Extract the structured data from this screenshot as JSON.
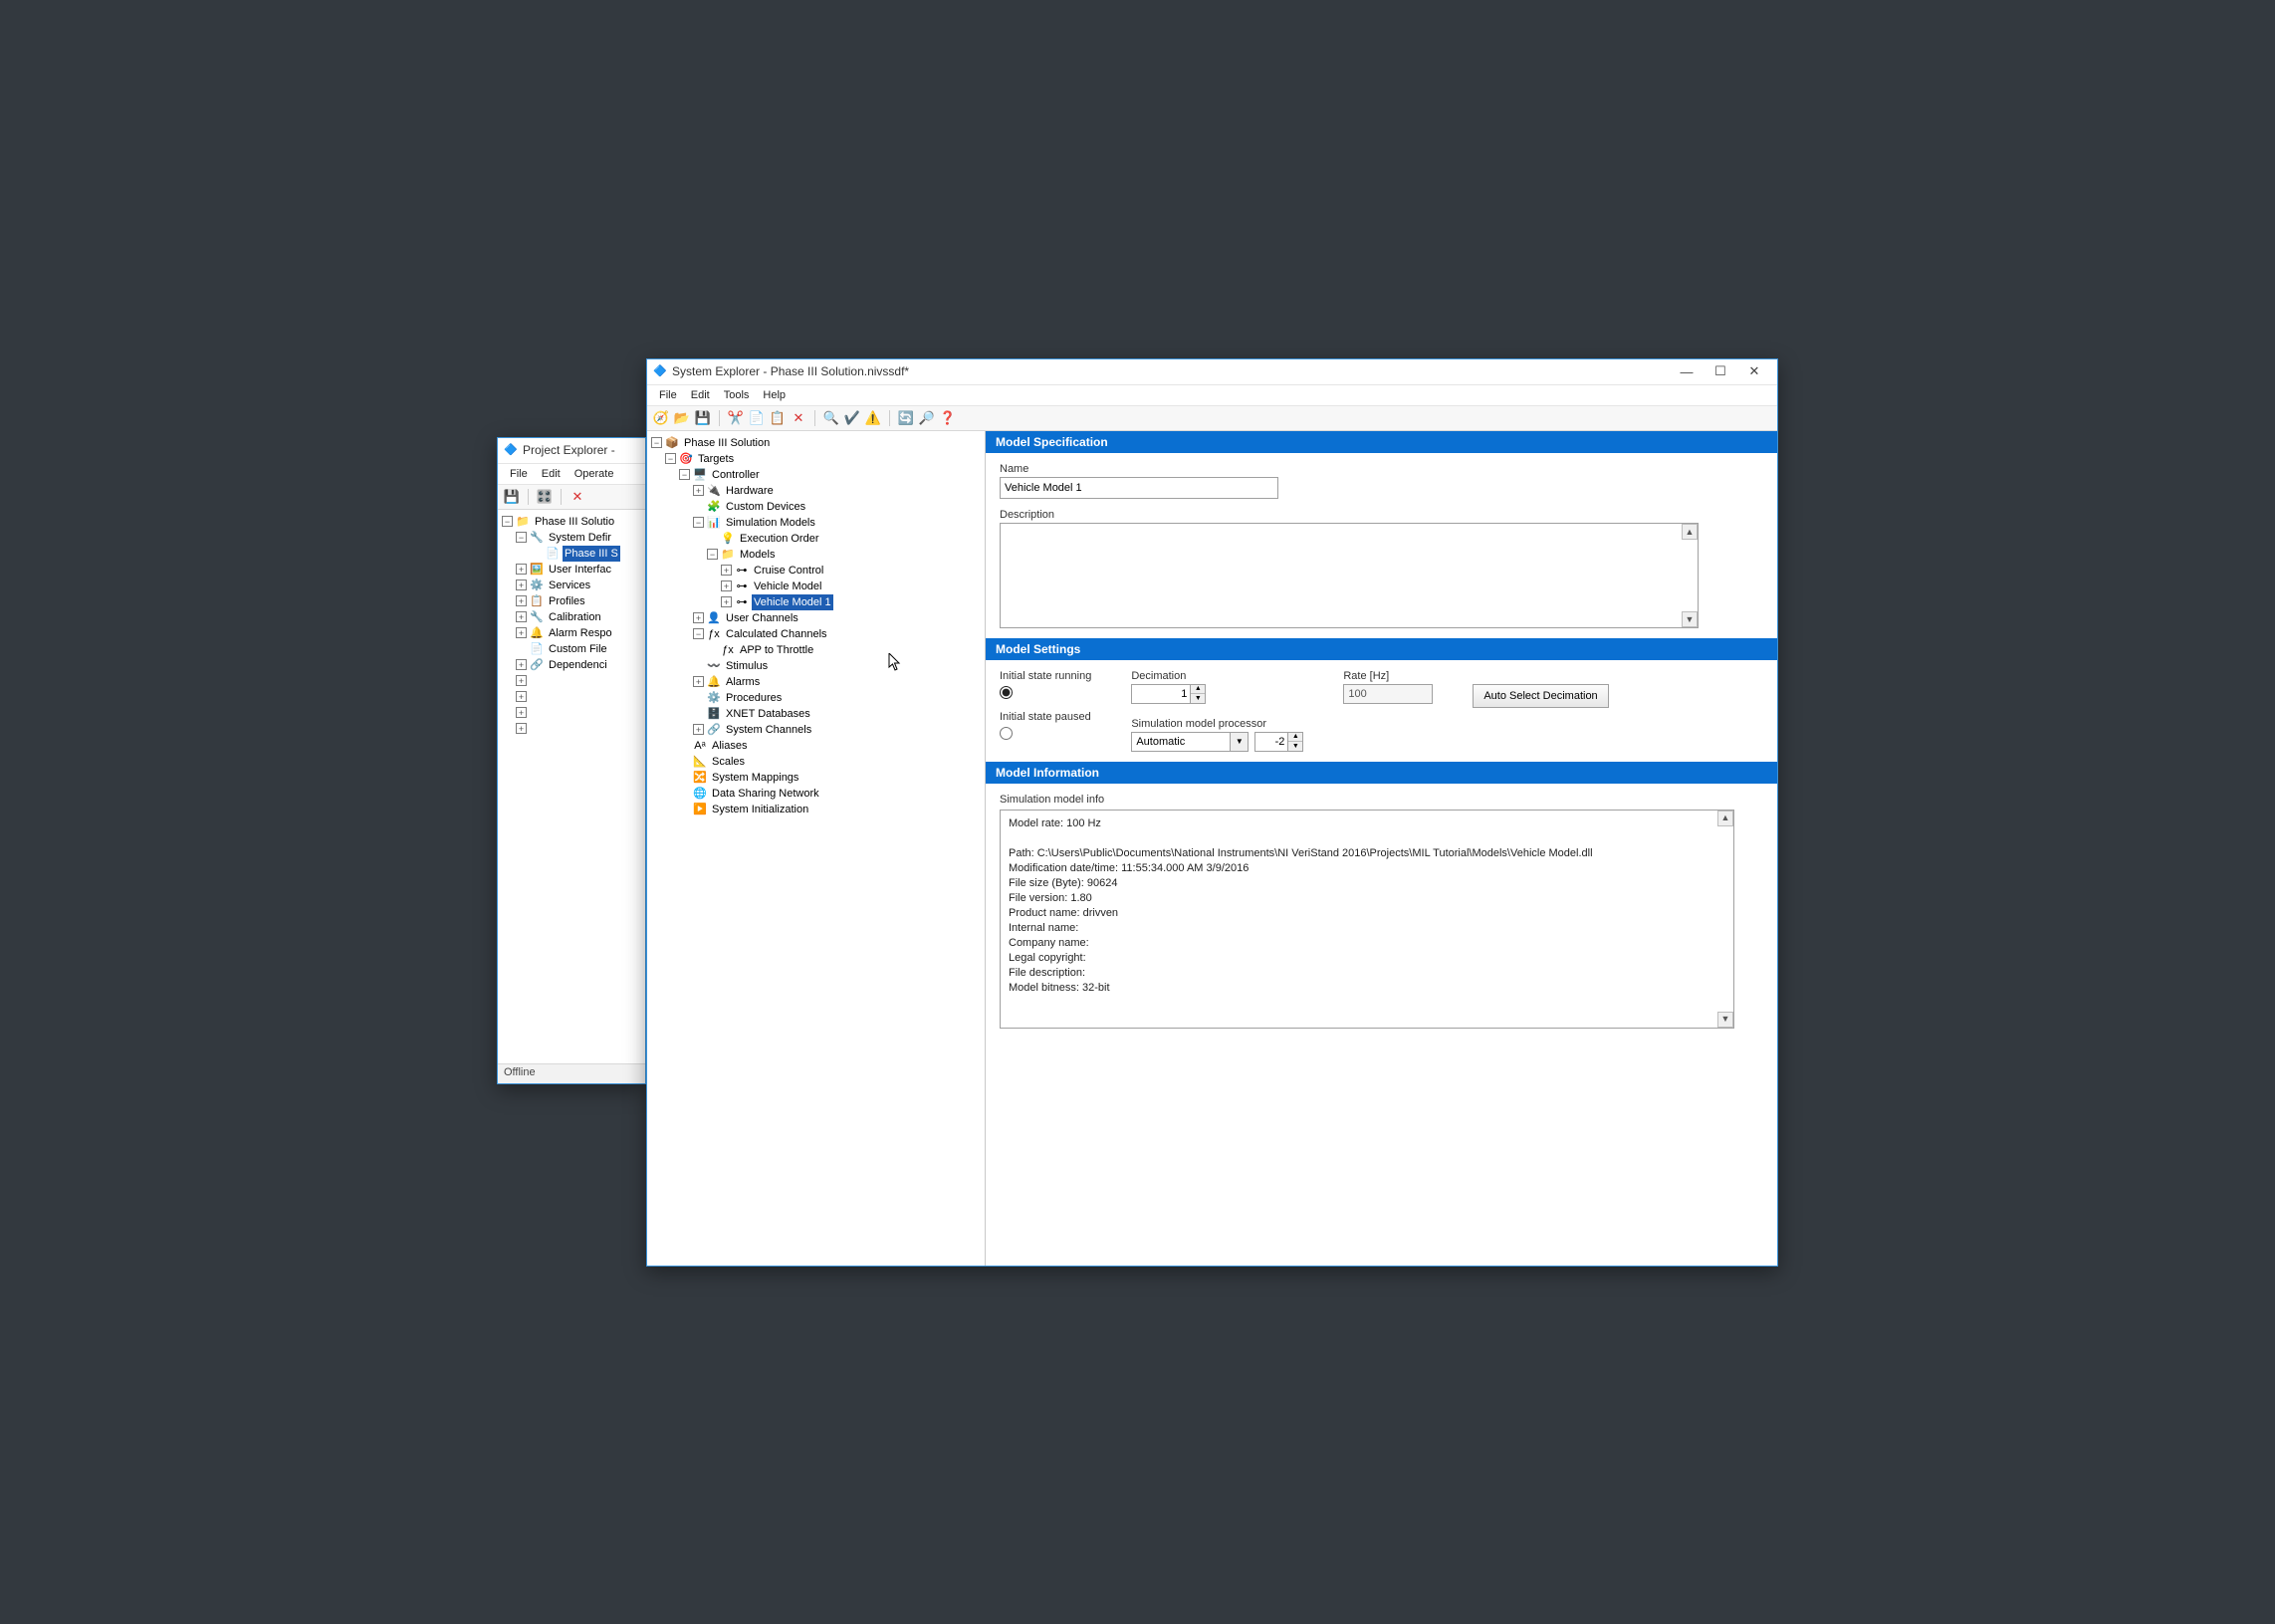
{
  "project_explorer": {
    "title": "Project Explorer - ",
    "menu": [
      "File",
      "Edit",
      "Operate"
    ],
    "tree": {
      "root": "Phase III Solutio",
      "items": [
        {
          "label": "System Defir",
          "prefix": ""
        },
        {
          "label": "Phase III S",
          "prefix": "",
          "sel": true
        },
        {
          "label": "User Interfac",
          "prefix": ""
        },
        {
          "label": "Services",
          "prefix": ""
        },
        {
          "label": "Profiles",
          "prefix": ""
        },
        {
          "label": "Calibration",
          "prefix": ""
        },
        {
          "label": "Alarm Respo",
          "prefix": ""
        },
        {
          "label": "Custom File",
          "prefix": ""
        },
        {
          "label": "Dependenci",
          "prefix": ""
        }
      ]
    },
    "status": "Offline"
  },
  "system_explorer": {
    "title": "System Explorer - Phase III Solution.nivssdf*",
    "menu": [
      "File",
      "Edit",
      "Tools",
      "Help"
    ],
    "tree": [
      {
        "d": 0,
        "e": "-",
        "ic": "📦",
        "label": "Phase III Solution"
      },
      {
        "d": 1,
        "e": "-",
        "ic": "🎯",
        "label": "Targets"
      },
      {
        "d": 2,
        "e": "-",
        "ic": "🖥️",
        "label": "Controller"
      },
      {
        "d": 3,
        "e": "+",
        "ic": "🔌",
        "label": "Hardware"
      },
      {
        "d": 3,
        "e": " ",
        "ic": "🧩",
        "label": "Custom Devices"
      },
      {
        "d": 3,
        "e": "-",
        "ic": "📊",
        "label": "Simulation Models"
      },
      {
        "d": 4,
        "e": " ",
        "ic": "💡",
        "label": "Execution Order"
      },
      {
        "d": 4,
        "e": "-",
        "ic": "📁",
        "label": "Models"
      },
      {
        "d": 5,
        "e": "+",
        "ic": "⊶",
        "label": "Cruise Control"
      },
      {
        "d": 5,
        "e": "+",
        "ic": "⊶",
        "label": "Vehicle Model"
      },
      {
        "d": 5,
        "e": "+",
        "ic": "⊶",
        "label": "Vehicle Model 1",
        "sel": true
      },
      {
        "d": 3,
        "e": "+",
        "ic": "👤",
        "label": "User Channels"
      },
      {
        "d": 3,
        "e": "-",
        "ic": "ƒx",
        "label": "Calculated Channels"
      },
      {
        "d": 4,
        "e": " ",
        "ic": "ƒx",
        "label": "APP to Throttle"
      },
      {
        "d": 3,
        "e": " ",
        "ic": "〰️",
        "label": "Stimulus"
      },
      {
        "d": 3,
        "e": "+",
        "ic": "🔔",
        "label": "Alarms"
      },
      {
        "d": 3,
        "e": " ",
        "ic": "⚙️",
        "label": "Procedures"
      },
      {
        "d": 3,
        "e": " ",
        "ic": "🗄️",
        "label": "XNET Databases"
      },
      {
        "d": 3,
        "e": "+",
        "ic": "🔗",
        "label": "System Channels"
      },
      {
        "d": 2,
        "e": " ",
        "ic": "Aᵃ",
        "label": "Aliases"
      },
      {
        "d": 2,
        "e": " ",
        "ic": "📐",
        "label": "Scales"
      },
      {
        "d": 2,
        "e": " ",
        "ic": "🔀",
        "label": "System Mappings"
      },
      {
        "d": 2,
        "e": " ",
        "ic": "🌐",
        "label": "Data Sharing Network"
      },
      {
        "d": 2,
        "e": " ",
        "ic": "▶️",
        "label": "System Initialization"
      }
    ]
  },
  "spec": {
    "header": "Model Specification",
    "name_label": "Name",
    "name_value": "Vehicle Model 1",
    "desc_label": "Description"
  },
  "settings": {
    "header": "Model Settings",
    "initial_running": "Initial state running",
    "initial_paused": "Initial state paused",
    "decimation_label": "Decimation",
    "decimation_value": "1",
    "rate_label": "Rate [Hz]",
    "rate_value": "100",
    "auto_select": "Auto Select Decimation",
    "proc_label": "Simulation model processor",
    "proc_value": "Automatic",
    "proc_spin": "-2"
  },
  "info": {
    "header": "Model Information",
    "subheader": "Simulation model info",
    "lines": [
      "Model rate: 100 Hz",
      "",
      "Path: C:\\Users\\Public\\Documents\\National Instruments\\NI VeriStand 2016\\Projects\\MIL Tutorial\\Models\\Vehicle Model.dll",
      "Modification date/time: 11:55:34.000 AM 3/9/2016",
      "File size (Byte): 90624",
      "File version: 1.80",
      "Product name: drivven",
      "Internal name:",
      "Company name:",
      "Legal copyright:",
      "File description:",
      "Model bitness: 32-bit"
    ]
  }
}
